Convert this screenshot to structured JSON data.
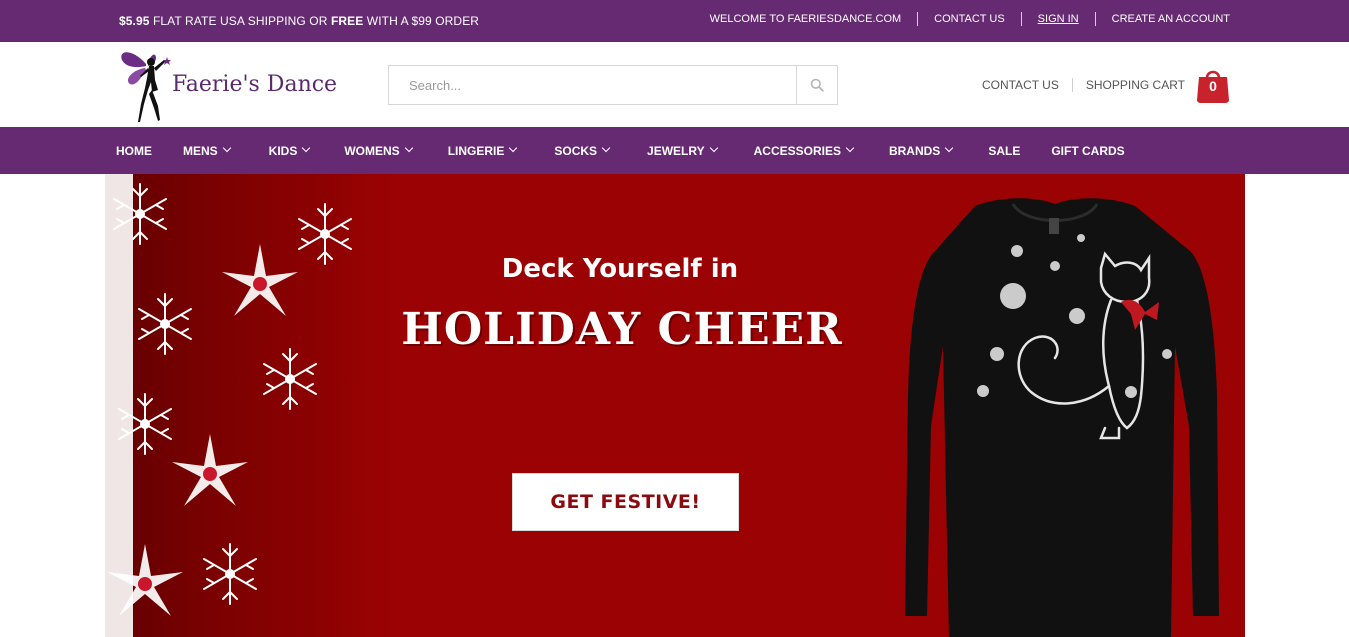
{
  "topbar": {
    "promo_price": "$5.95",
    "promo_text1": " FLAT RATE USA SHIPPING OR ",
    "promo_free": "FREE",
    "promo_text2": " WITH A $99 ORDER",
    "links": [
      "WELCOME TO FAERIESDANCE.COM",
      "CONTACT US",
      "SIGN IN",
      "CREATE AN ACCOUNT"
    ]
  },
  "header": {
    "logo_text": "Faerie's Dance",
    "search_placeholder": "Search...",
    "search_icon": "search-icon",
    "contact_label": "CONTACT US",
    "cart_label": "SHOPPING CART",
    "cart_count": "0",
    "cart_icon": "shopping-bag-icon"
  },
  "nav": {
    "items": [
      {
        "label": "HOME",
        "dropdown": false
      },
      {
        "label": "MENS",
        "dropdown": true
      },
      {
        "label": "KIDS",
        "dropdown": true
      },
      {
        "label": "WOMENS",
        "dropdown": true
      },
      {
        "label": "LINGERIE",
        "dropdown": true
      },
      {
        "label": "SOCKS",
        "dropdown": true
      },
      {
        "label": "JEWELRY",
        "dropdown": true
      },
      {
        "label": "ACCESSORIES",
        "dropdown": true
      },
      {
        "label": "BRANDS",
        "dropdown": true
      },
      {
        "label": "SALE",
        "dropdown": false
      },
      {
        "label": "GIFT CARDS",
        "dropdown": false
      }
    ]
  },
  "hero": {
    "headline": "Deck Yourself in",
    "headline_big": "HOLIDAY CHEER",
    "cta_label": "GET FESTIVE!"
  },
  "colors": {
    "brand_purple": "#652a72",
    "hero_red": "#9a0203",
    "cart_red": "#c8232c"
  }
}
